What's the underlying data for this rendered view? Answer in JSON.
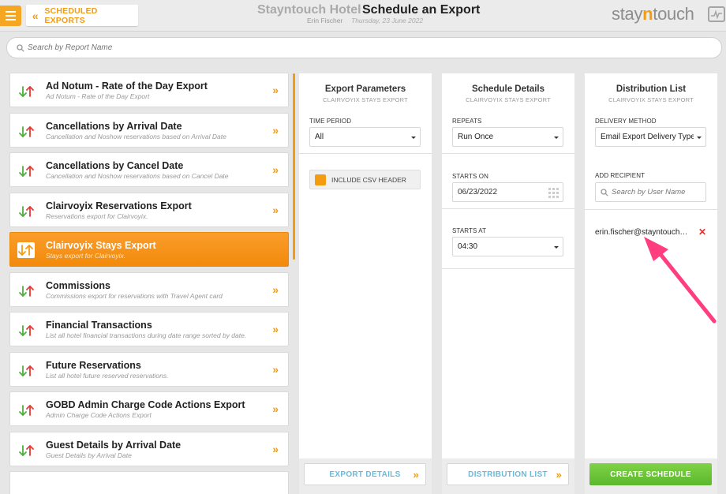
{
  "header": {
    "back_label": "SCHEDULED EXPORTS",
    "hotel_name": "Stayntouch Hotel",
    "page_title": "Schedule an Export",
    "user_name": "Erin Fischer",
    "date": "Thursday, 23 June 2022",
    "logo_prefix": "stay",
    "logo_mid": "n",
    "logo_suffix": "touch"
  },
  "search": {
    "placeholder": "Search by Report Name"
  },
  "reports": [
    {
      "title": "Ad Notum - Rate of the Day Export",
      "desc": "Ad Notum - Rate of the Day Export"
    },
    {
      "title": "Cancellations by Arrival Date",
      "desc": "Cancellation and Noshow reservations based on Arrival Date"
    },
    {
      "title": "Cancellations by Cancel Date",
      "desc": "Cancellation and Noshow reservations based on Cancel Date"
    },
    {
      "title": "Clairvoyix Reservations Export",
      "desc": "Reservations export for Clairvoyix."
    },
    {
      "title": "Clairvoyix Stays Export",
      "desc": "Stays export for Clairvoyix.",
      "active": true
    },
    {
      "title": "Commissions",
      "desc": "Commissions export for reservations with Travel Agent card"
    },
    {
      "title": "Financial Transactions",
      "desc": "List all hotel financial transactions during date range sorted by date."
    },
    {
      "title": "Future Reservations",
      "desc": "List all hotel future reserved reservations."
    },
    {
      "title": "GOBD Admin Charge Code Actions Export",
      "desc": "Admin Charge Code Actions Export"
    },
    {
      "title": "Guest Details by Arrival Date",
      "desc": "Guest Details by Arrival Date"
    }
  ],
  "export_params": {
    "title": "Export Parameters",
    "subtitle": "CLAIRVOYIX STAYS EXPORT",
    "time_period_label": "TIME PERIOD",
    "time_period_value": "All",
    "csv_header_label": "INCLUDE CSV HEADER",
    "footer_button": "EXPORT DETAILS"
  },
  "schedule": {
    "title": "Schedule Details",
    "subtitle": "CLAIRVOYIX STAYS EXPORT",
    "repeats_label": "REPEATS",
    "repeats_value": "Run Once",
    "starts_on_label": "STARTS ON",
    "starts_on_value": "06/23/2022",
    "starts_at_label": "STARTS AT",
    "starts_at_value": "04:30",
    "footer_button": "DISTRIBUTION LIST"
  },
  "distribution": {
    "title": "Distribution List",
    "subtitle": "CLAIRVOYIX STAYS EXPORT",
    "delivery_label": "DELIVERY METHOD",
    "delivery_value": "Email Export Delivery Type",
    "add_recipient_label": "ADD RECIPIENT",
    "recipient_placeholder": "Search by User Name",
    "recipient": "erin.fischer@stayntouch.com",
    "footer_button": "CREATE SCHEDULE"
  },
  "colors": {
    "accent": "#f39c12",
    "link_blue": "#6cb8d8",
    "create_green": "#6cc63a",
    "remove_red": "#e0302f",
    "annotation_pink": "#ff3d7f"
  }
}
